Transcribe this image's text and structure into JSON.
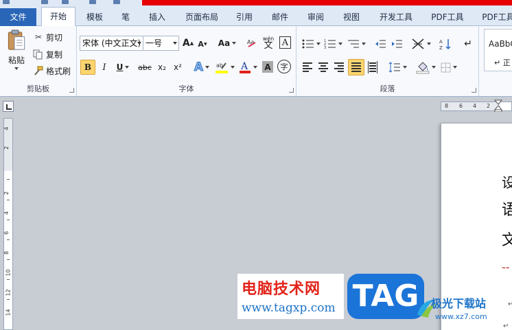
{
  "tabs": {
    "file": "文件",
    "items": [
      "开始",
      "模板",
      "笔",
      "插入",
      "页面布局",
      "引用",
      "邮件",
      "审阅",
      "视图",
      "开发工具",
      "PDF工具",
      "PDF工具"
    ]
  },
  "clipboard": {
    "paste": "粘贴",
    "cut": "剪切",
    "copy": "复制",
    "format_painter": "格式刷",
    "group_label": "剪贴板"
  },
  "font": {
    "font_name": "宋体 (中文正文)",
    "font_size": "一号",
    "aa_label": "Aa",
    "phonetic_label": "wén",
    "phonetic_char": "文",
    "border_char": "A",
    "group_label": "字体",
    "bold": "B",
    "italic": "I",
    "underline": "U",
    "strike": "abc",
    "sub": "x₂",
    "sup": "x²",
    "enclose": "字",
    "highlight_color": "#ffff00",
    "font_color": "#e2231a"
  },
  "paragraph": {
    "group_label": "段落"
  },
  "styles": {
    "preview": "AaBbC",
    "name": "↵ 正"
  },
  "ruler": {
    "h_numbers": [
      "8",
      "6",
      "4",
      "2"
    ],
    "v_numbers": [
      "4",
      "2",
      "2",
      "4",
      "6",
      "8",
      "10",
      "12",
      "14"
    ]
  },
  "document": {
    "lines": [
      "设",
      "语",
      "文"
    ],
    "dash": "--"
  },
  "watermark": {
    "title": "电脑技术网",
    "url": "www.tagxp.com",
    "tag": "TAG",
    "site": "极光下载站",
    "site_url": "www.xz7.com"
  },
  "colors": {
    "file_tab": "#2a66b7",
    "accent_red": "#e60000",
    "tag_blue": "#1b74d8"
  }
}
